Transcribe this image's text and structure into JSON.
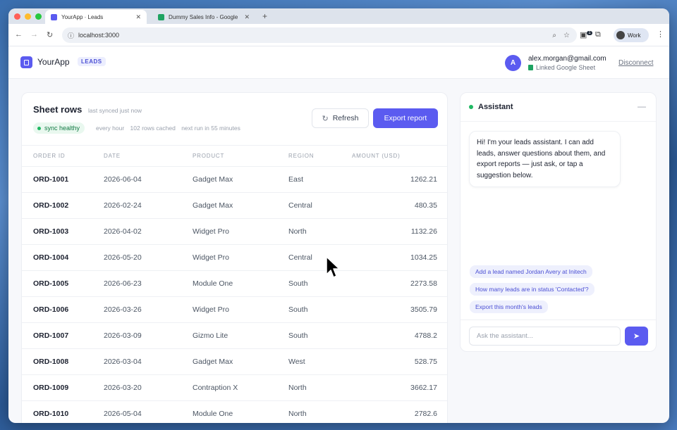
{
  "browser": {
    "tabs": [
      {
        "title": "YourApp · Leads",
        "favicon_color": "#5b5bf0"
      },
      {
        "title": "Dummy Sales Info - Google S",
        "favicon_color": "#1ea362"
      }
    ],
    "url": "localhost:3000",
    "profile": "Work",
    "extension_badge": "1"
  },
  "app": {
    "name": "YourApp",
    "badge": "LEADS",
    "user": {
      "initial": "A",
      "email": "alex.morgan@gmail.com",
      "linked": "Linked Google Sheet"
    },
    "disconnect": "Disconnect"
  },
  "sheet": {
    "title": "Sheet rows",
    "synced": "last synced just now",
    "status": "sync healthy",
    "meta": [
      "every hour",
      "102 rows cached",
      "next run in 55 minutes"
    ],
    "refresh_label": "Refresh",
    "export_label": "Export report",
    "columns": [
      "ORDER ID",
      "DATE",
      "PRODUCT",
      "REGION",
      "AMOUNT (USD)"
    ],
    "rows": [
      [
        "ORD-1001",
        "2026-06-04",
        "Gadget Max",
        "East",
        "1262.21"
      ],
      [
        "ORD-1002",
        "2026-02-24",
        "Gadget Max",
        "Central",
        "480.35"
      ],
      [
        "ORD-1003",
        "2026-04-02",
        "Widget Pro",
        "North",
        "1132.26"
      ],
      [
        "ORD-1004",
        "2026-05-20",
        "Widget Pro",
        "Central",
        "1034.25"
      ],
      [
        "ORD-1005",
        "2026-06-23",
        "Module One",
        "South",
        "2273.58"
      ],
      [
        "ORD-1006",
        "2026-03-26",
        "Widget Pro",
        "South",
        "3505.79"
      ],
      [
        "ORD-1007",
        "2026-03-09",
        "Gizmo Lite",
        "South",
        "4788.2"
      ],
      [
        "ORD-1008",
        "2026-03-04",
        "Gadget Max",
        "West",
        "528.75"
      ],
      [
        "ORD-1009",
        "2026-03-20",
        "Contraption X",
        "North",
        "3662.17"
      ],
      [
        "ORD-1010",
        "2026-05-04",
        "Module One",
        "North",
        "2782.6"
      ]
    ]
  },
  "assistant": {
    "title": "Assistant",
    "greeting": "Hi! I'm your leads assistant. I can add leads, answer questions about them, and export reports — just ask, or tap a suggestion below.",
    "suggestions": [
      "Add a lead named Jordan Avery at Initech",
      "How many leads are in status 'Contacted'?",
      "Export this month's leads"
    ],
    "input_placeholder": "Ask the assistant..."
  }
}
